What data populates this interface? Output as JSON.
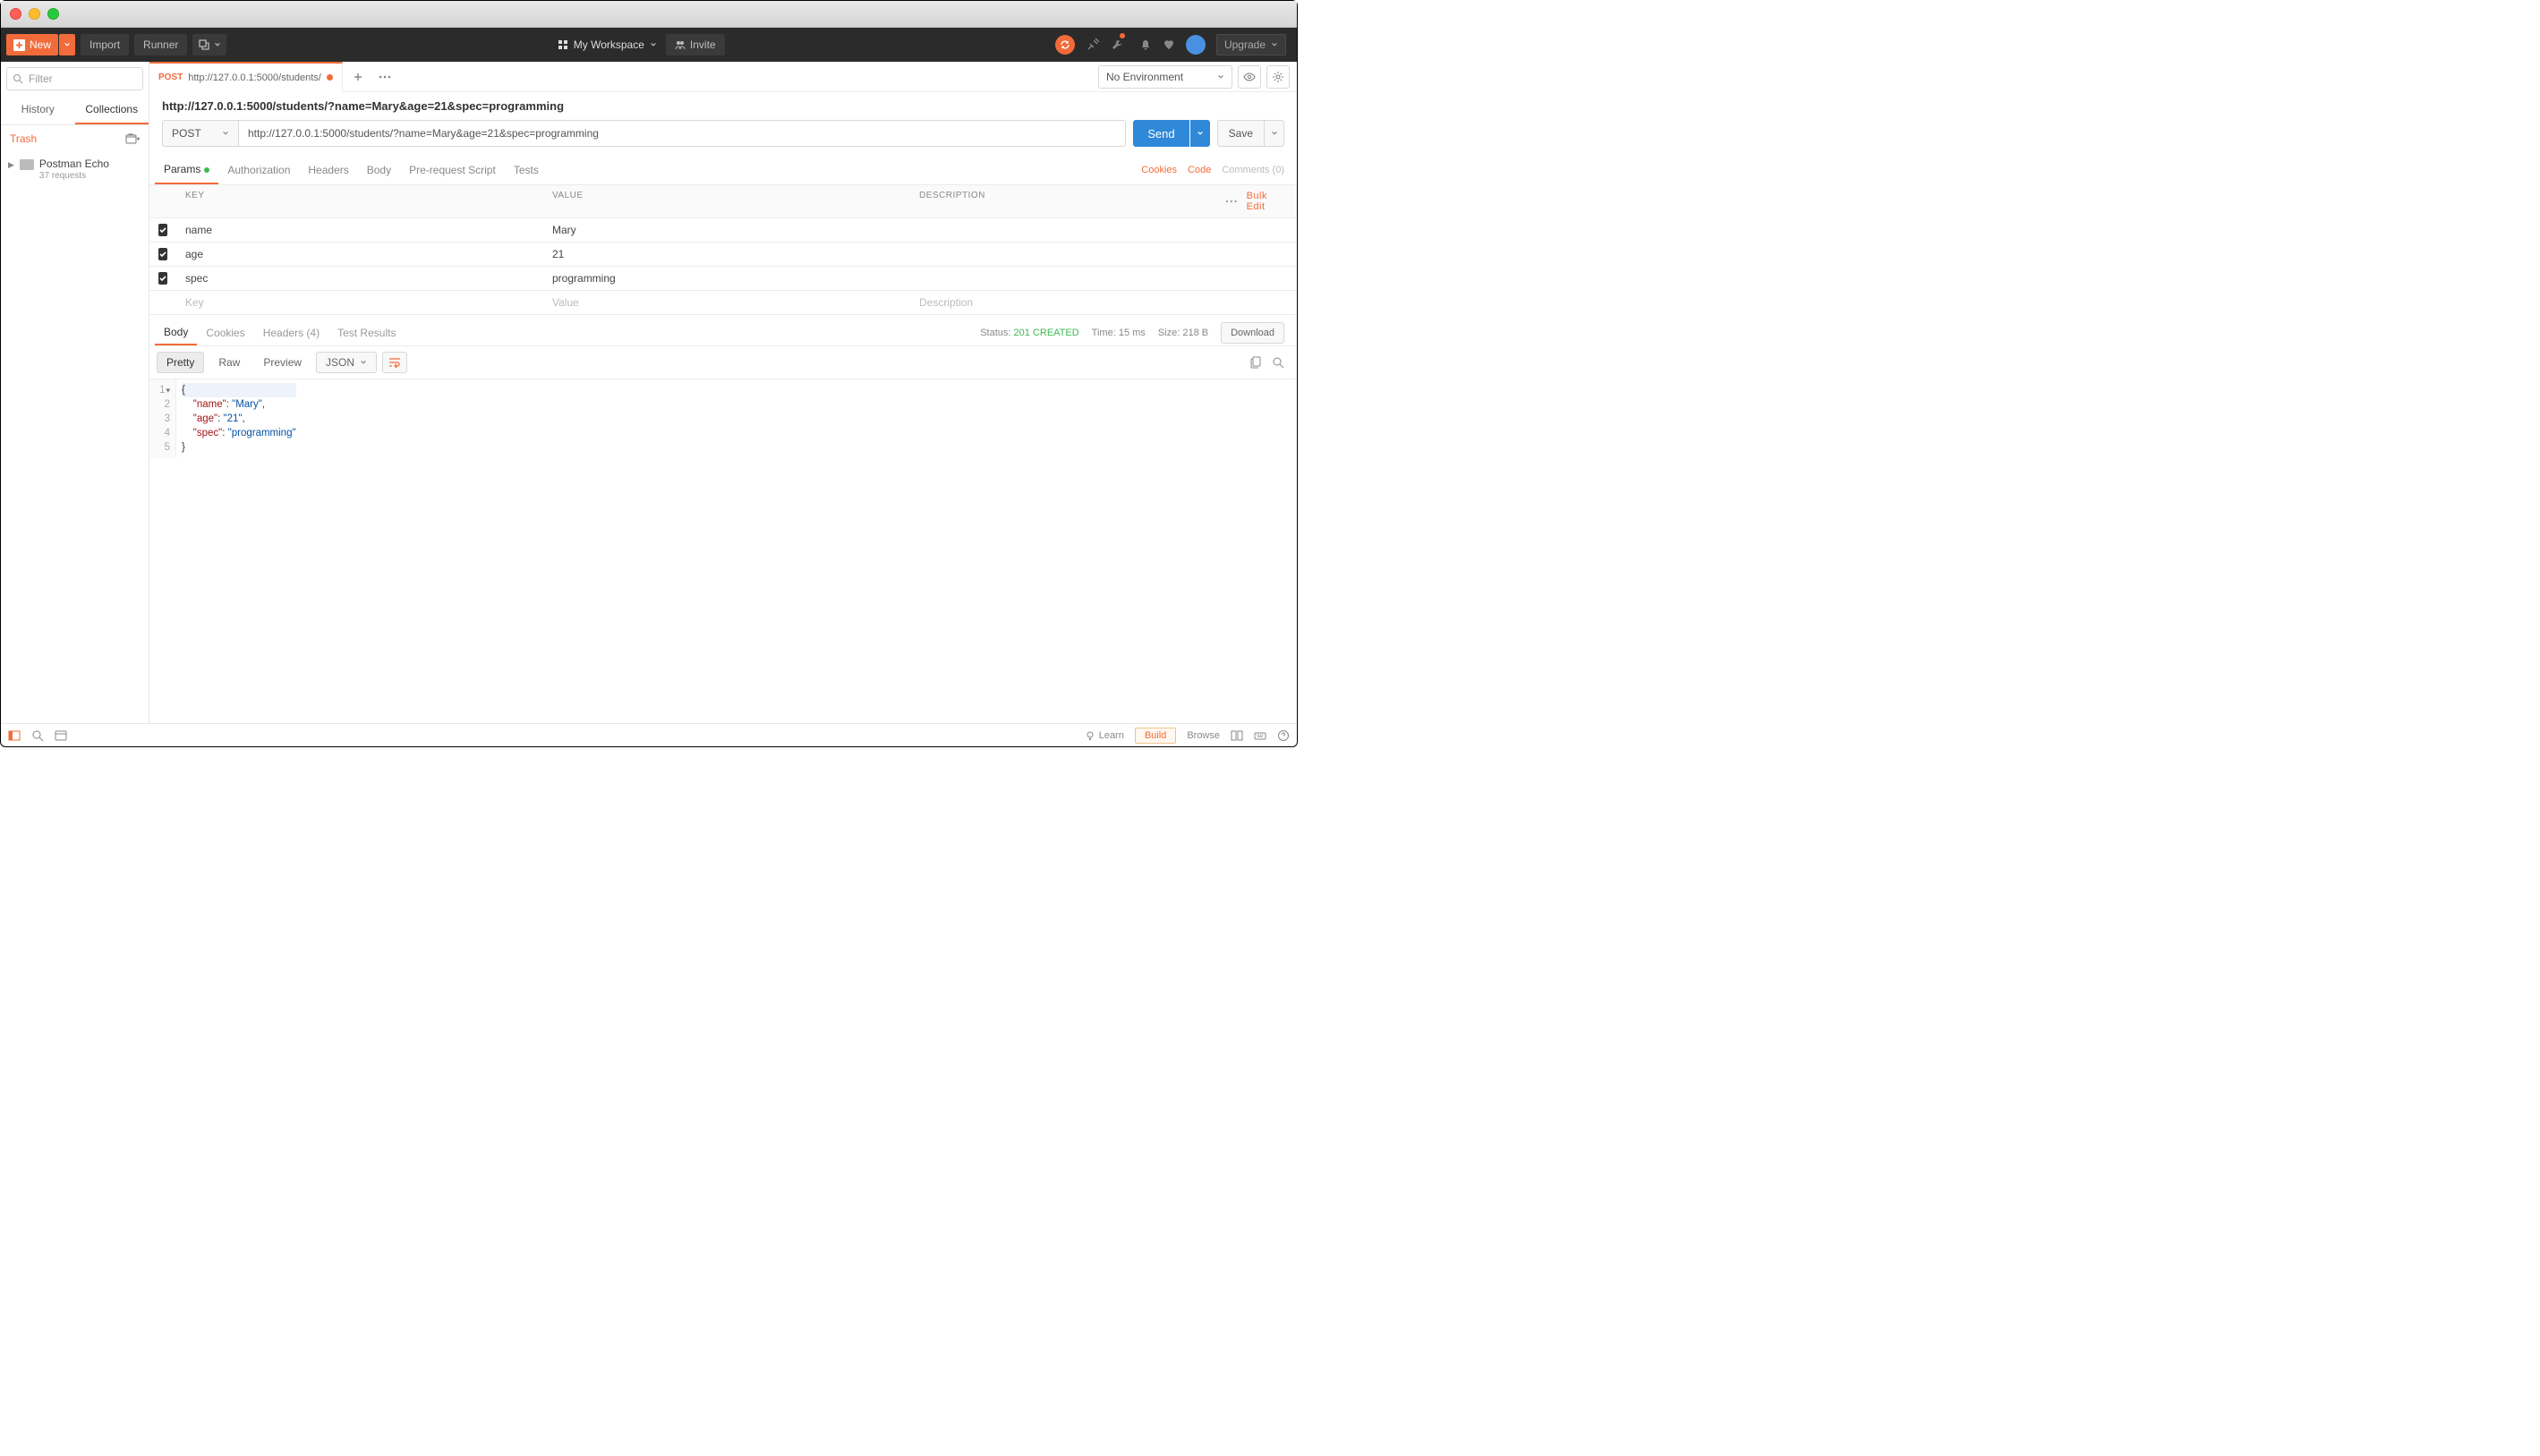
{
  "topbar": {
    "new_label": "New",
    "import_label": "Import",
    "runner_label": "Runner",
    "workspace_label": "My Workspace",
    "invite_label": "Invite",
    "upgrade_label": "Upgrade"
  },
  "sidebar": {
    "filter_placeholder": "Filter",
    "tabs": {
      "history": "History",
      "collections": "Collections"
    },
    "trash_label": "Trash",
    "collection": {
      "name": "Postman Echo",
      "sub": "37 requests"
    }
  },
  "request_tab": {
    "method": "POST",
    "url_short": "http://127.0.0.1:5000/students/"
  },
  "env": {
    "none": "No Environment"
  },
  "request": {
    "name": "http://127.0.0.1:5000/students/?name=Mary&age=21&spec=programming",
    "method": "POST",
    "url": "http://127.0.0.1:5000/students/?name=Mary&age=21&spec=programming",
    "send": "Send",
    "save": "Save"
  },
  "req_subtabs": {
    "params": "Params",
    "auth": "Authorization",
    "headers": "Headers",
    "body": "Body",
    "prerequest": "Pre-request Script",
    "tests": "Tests",
    "cookies": "Cookies",
    "code": "Code",
    "comments": "Comments (0)"
  },
  "params_table": {
    "cols": {
      "key": "KEY",
      "value": "VALUE",
      "desc": "DESCRIPTION",
      "bulk": "Bulk Edit"
    },
    "rows": [
      {
        "key": "name",
        "value": "Mary"
      },
      {
        "key": "age",
        "value": "21"
      },
      {
        "key": "spec",
        "value": "programming"
      }
    ],
    "placeholder": {
      "key": "Key",
      "value": "Value",
      "desc": "Description"
    }
  },
  "response": {
    "tabs": {
      "body": "Body",
      "cookies": "Cookies",
      "headers": "Headers",
      "headers_count": "(4)",
      "tests": "Test Results"
    },
    "status_label": "Status:",
    "status_value": "201 CREATED",
    "time_label": "Time:",
    "time_value": "15 ms",
    "size_label": "Size:",
    "size_value": "218 B",
    "download": "Download",
    "pretty": "Pretty",
    "raw": "Raw",
    "preview": "Preview",
    "json": "JSON",
    "body_json": {
      "name": "Mary",
      "age": "21",
      "spec": "programming"
    }
  },
  "status": {
    "learn": "Learn",
    "build": "Build",
    "browse": "Browse"
  }
}
